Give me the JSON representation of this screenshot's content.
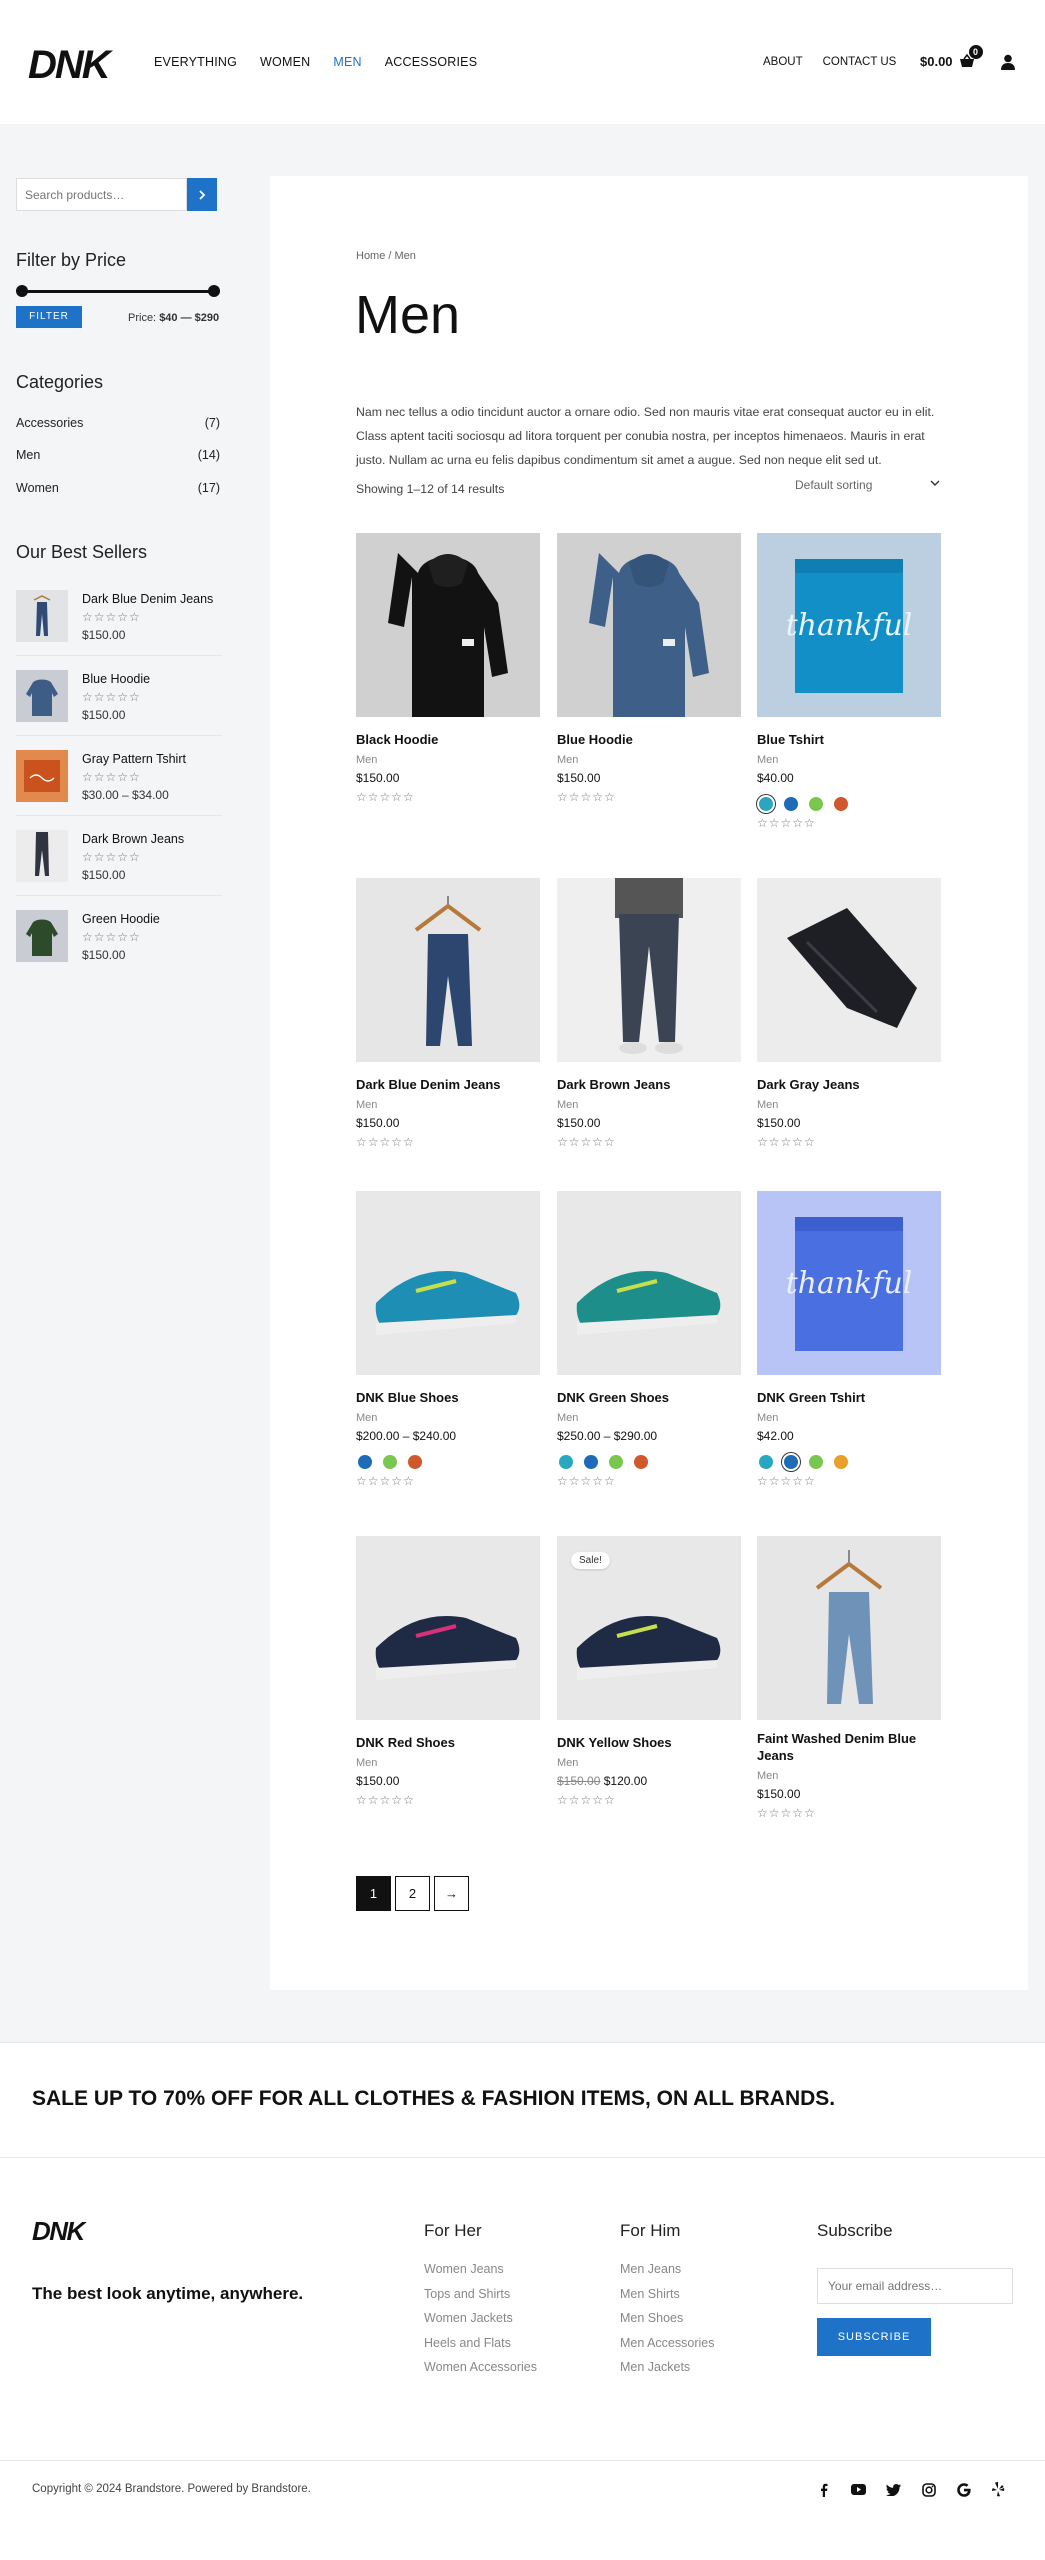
{
  "brand": {
    "logo": "DNK",
    "accent": "#1e73c8"
  },
  "nav": {
    "items": [
      "Everything",
      "Women",
      "Men",
      "Accessories"
    ],
    "active": "Men",
    "right_items": [
      "ABOUT",
      "CONTACT US"
    ],
    "cart_total": "$0.00",
    "cart_count": "0"
  },
  "sidebar": {
    "search_placeholder": "Search products…",
    "filter_title": "Filter by Price",
    "filter_button": "FILTER",
    "price_label": "Price:",
    "price_value": "$40 — $290",
    "categories_title": "Categories",
    "categories": [
      {
        "name": "Accessories",
        "count": "(7)"
      },
      {
        "name": "Men",
        "count": "(14)"
      },
      {
        "name": "Women",
        "count": "(17)"
      }
    ],
    "bestsellers_title": "Our Best Sellers",
    "bestsellers": [
      {
        "name": "Dark Blue Denim Jeans",
        "price": "$150.00",
        "stars": "☆☆☆☆☆",
        "icon": "jeans-hanger"
      },
      {
        "name": "Blue Hoodie",
        "price": "$150.00",
        "stars": "☆☆☆☆☆",
        "icon": "hoodie-blue"
      },
      {
        "name": "Gray Pattern Tshirt",
        "price": "$30.00 – $34.00",
        "stars": "☆☆☆☆☆",
        "icon": "tshirt-orange"
      },
      {
        "name": "Dark Brown Jeans",
        "price": "$150.00",
        "stars": "☆☆☆☆☆",
        "icon": "jeans-legs"
      },
      {
        "name": "Green Hoodie",
        "price": "$150.00",
        "stars": "☆☆☆☆☆",
        "icon": "hoodie-green"
      }
    ]
  },
  "main": {
    "breadcrumb": "Home / Men",
    "title": "Men",
    "description": "Nam nec tellus a odio tincidunt auctor a ornare odio. Sed non mauris vitae erat consequat auctor eu in elit. Class aptent taciti sociosqu ad litora torquent per conubia nostra, per inceptos himenaeos. Mauris in erat justo. Nullam ac urna eu felis dapibus condimentum sit amet a augue. Sed non neque elit sed ut.",
    "showing": "Showing 1–12 of 14 results",
    "sorting": "Default sorting",
    "products": [
      {
        "name": "Black Hoodie",
        "category": "Men",
        "price": "$150.00",
        "stars": "☆☆☆☆☆",
        "image": "hoodie-black"
      },
      {
        "name": "Blue Hoodie",
        "category": "Men",
        "price": "$150.00",
        "stars": "☆☆☆☆☆",
        "image": "hoodie-blue"
      },
      {
        "name": "Blue Tshirt",
        "category": "Men",
        "price": "$40.00",
        "stars": "☆☆☆☆☆",
        "image": "tshirt-teal",
        "swatches": [
          "#2aa7c0",
          "#1e6bb8",
          "#7ac74f",
          "#d0582c"
        ],
        "selected_swatch": 0
      },
      {
        "name": "Dark Blue Denim Jeans",
        "category": "Men",
        "price": "$150.00",
        "stars": "☆☆☆☆☆",
        "image": "jeans-hanger-dark"
      },
      {
        "name": "Dark Brown Jeans",
        "category": "Men",
        "price": "$150.00",
        "stars": "☆☆☆☆☆",
        "image": "jeans-legs"
      },
      {
        "name": "Dark Gray Jeans",
        "category": "Men",
        "price": "$150.00",
        "stars": "☆☆☆☆☆",
        "image": "jeans-folded"
      },
      {
        "name": "DNK Blue Shoes",
        "category": "Men",
        "price": "$200.00 – $240.00",
        "stars": "☆☆☆☆☆",
        "image": "shoes-teal",
        "swatches": [
          "#1e6bb8",
          "#7ac74f",
          "#d0582c"
        ]
      },
      {
        "name": "DNK Green Shoes",
        "category": "Men",
        "price": "$250.00 – $290.00",
        "stars": "☆☆☆☆☆",
        "image": "shoes-teal",
        "swatches": [
          "#2aa7c0",
          "#1e6bb8",
          "#7ac74f",
          "#d0582c"
        ]
      },
      {
        "name": "DNK Green Tshirt",
        "category": "Men",
        "price": "$42.00",
        "stars": "☆☆☆☆☆",
        "image": "tshirt-blue",
        "swatches": [
          "#2aa7c0",
          "#1e6bb8",
          "#7ac74f",
          "#e8a02a"
        ],
        "selected_swatch": 1
      },
      {
        "name": "DNK Red Shoes",
        "category": "Men",
        "price": "$150.00",
        "stars": "☆☆☆☆☆",
        "image": "shoes-red"
      },
      {
        "name": "DNK Yellow Shoes",
        "category": "Men",
        "price_old": "$150.00",
        "price": "$120.00",
        "stars": "☆☆☆☆☆",
        "image": "shoes-yellow",
        "badge": "Sale!"
      },
      {
        "name": "Faint Washed Denim Blue Jeans",
        "category": "Men",
        "price": "$150.00",
        "stars": "☆☆☆☆☆",
        "image": "jeans-hanger-light"
      }
    ],
    "pagination": [
      "1",
      "2",
      "→"
    ]
  },
  "promo": {
    "text": "SALE UP TO 70% OFF FOR ALL CLOTHES & FASHION ITEMS, ON ALL BRANDS."
  },
  "footer": {
    "tagline": "The best look anytime, anywhere.",
    "columns": [
      {
        "title": "For Her",
        "links": [
          "Women Jeans",
          "Tops and Shirts",
          "Women Jackets",
          "Heels and Flats",
          "Women Accessories"
        ]
      },
      {
        "title": "For Him",
        "links": [
          "Men Jeans",
          "Men Shirts",
          "Men Shoes",
          "Men Accessories",
          "Men Jackets"
        ]
      }
    ],
    "subscribe_title": "Subscribe",
    "email_placeholder": "Your email address…",
    "subscribe_button": "SUBSCRIBE",
    "copyright": "Copyright © 2024 Brandstore. Powered by Brandstore.",
    "social": [
      "facebook-icon",
      "youtube-icon",
      "twitter-icon",
      "instagram-icon",
      "google-icon",
      "yelp-icon"
    ]
  }
}
